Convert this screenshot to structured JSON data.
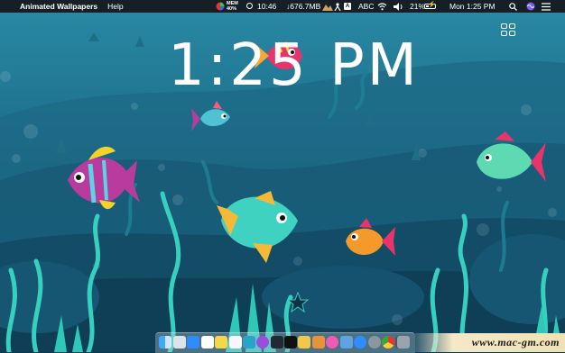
{
  "menubar": {
    "apple_glyph": "",
    "app_name": "Animated Wallpapers",
    "menu_help": "Help",
    "mem_label": "MEM",
    "mem_value": "40%",
    "time_tracker": "10:46",
    "network_speed": "↓676.7MB",
    "input_source": "ABC",
    "input_badge": "A",
    "battery_percent": "21%",
    "date_time": "Mon 1:25 PM"
  },
  "wallpaper": {
    "clock_text": "1:25 PM",
    "grid_icon": "grid-icon"
  },
  "dock": {
    "apps": [
      "finder",
      "launchpad",
      "app-store",
      "calendar",
      "notes",
      "reminders",
      "photos",
      "podcasts",
      "music-widget",
      "clock-widget",
      "stickies",
      "books",
      "itunes",
      "preview",
      "safari",
      "system-preferences",
      "chrome",
      "activity",
      "trash"
    ]
  },
  "watermark": {
    "text": "www.mac-gm.com"
  },
  "colors": {
    "sea_top": "#2b8fa8",
    "sea_deep": "#0b3a52",
    "seaweed": "#3ed9c7",
    "accent_fish": "#ff5a7a"
  }
}
